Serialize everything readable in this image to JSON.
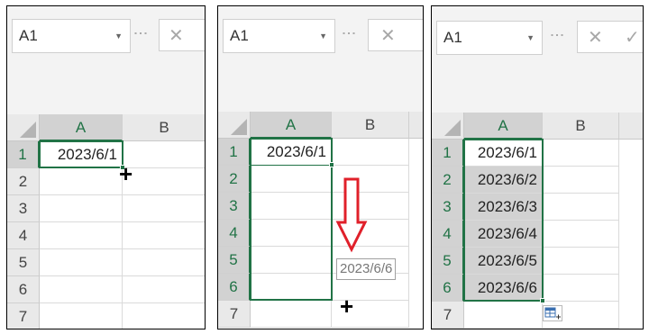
{
  "panels": [
    {
      "name_box": "A1",
      "formula_buttons": [
        "✕"
      ],
      "columns": [
        "A",
        "B"
      ],
      "rows": [
        "1",
        "2",
        "3",
        "4",
        "5",
        "6",
        "7"
      ],
      "cells_a": [
        "2023/6/1",
        "",
        "",
        "",
        "",
        "",
        ""
      ],
      "cursor": "+"
    },
    {
      "name_box": "A1",
      "formula_buttons": [
        "✕"
      ],
      "columns": [
        "A",
        "B"
      ],
      "rows": [
        "1",
        "2",
        "3",
        "4",
        "5",
        "6",
        "7"
      ],
      "cells_a": [
        "2023/6/1",
        "",
        "",
        "",
        "",
        "",
        ""
      ],
      "drag_tooltip": "2023/6/6",
      "cursor": "+",
      "arrow_color": "#e0202a"
    },
    {
      "name_box": "A1",
      "formula_buttons": [
        "✕",
        "✓"
      ],
      "columns": [
        "A",
        "B"
      ],
      "rows": [
        "1",
        "2",
        "3",
        "4",
        "5",
        "6",
        "7"
      ],
      "cells_a": [
        "2023/6/1",
        "2023/6/2",
        "2023/6/3",
        "2023/6/4",
        "2023/6/5",
        "2023/6/6",
        ""
      ],
      "autofill_icon": "auto-fill-options-icon"
    }
  ],
  "colors": {
    "selection": "#217346",
    "header": "#e9e9e9",
    "highlight": "#d2d2d2",
    "arrow": "#e0202a"
  }
}
